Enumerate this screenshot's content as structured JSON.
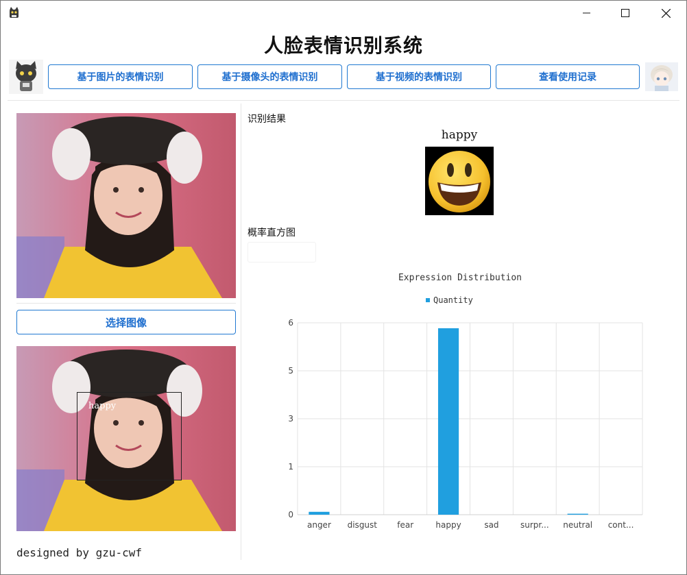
{
  "window": {
    "title": "",
    "controls": {
      "minimize": "minimize-icon",
      "maximize": "maximize-icon",
      "close": "close-icon"
    }
  },
  "header": {
    "title": "人脸表情识别系统"
  },
  "nav": {
    "buttons": [
      {
        "label": "基于图片的表情识别"
      },
      {
        "label": "基于摄像头的表情识别"
      },
      {
        "label": "基于视频的表情识别"
      },
      {
        "label": "查看使用记录"
      }
    ]
  },
  "left": {
    "select_button": "选择图像",
    "detected_label": "happy",
    "credit": "designed by gzu-cwf"
  },
  "right": {
    "result_heading": "识别结果",
    "result_text": "happy",
    "result_icon": "smiling-emoji-icon",
    "histogram_heading": "概率直方图"
  },
  "colors": {
    "accent": "#1f78d1",
    "bar": "#209fdf"
  },
  "chart_data": {
    "type": "bar",
    "title": "Expression Distribution",
    "legend": [
      "Quantity"
    ],
    "legend_position": "top-center",
    "categories": [
      "anger",
      "disgust",
      "fear",
      "happy",
      "sad",
      "surpr...",
      "neutral",
      "cont..."
    ],
    "series": [
      {
        "name": "Quantity",
        "values": [
          0.09,
          0.0,
          0.0,
          5.83,
          0.0,
          0.0,
          0.03,
          0.0
        ]
      }
    ],
    "y_ticks": [
      "0",
      "1",
      "3",
      "5",
      "6"
    ],
    "y_tick_values": [
      0,
      1.5,
      3,
      4.5,
      6
    ],
    "ylim": [
      0,
      6
    ],
    "grid": true
  }
}
